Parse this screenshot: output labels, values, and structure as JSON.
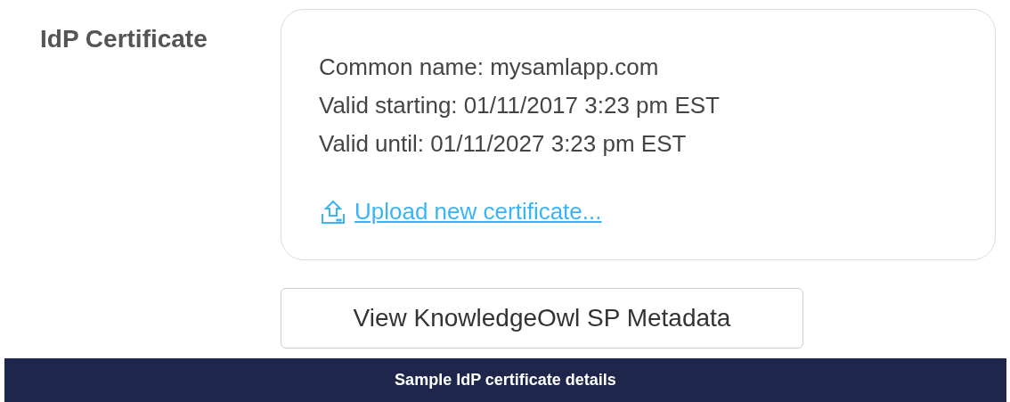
{
  "section_label": "IdP Certificate",
  "certificate": {
    "lines": [
      "Common name: mysamlapp.com",
      "Valid starting: 01/11/2017 3:23 pm EST",
      "Valid until: 01/11/2027 3:23 pm EST"
    ],
    "upload_link": "Upload new certificate..."
  },
  "metadata_button": "View KnowledgeOwl SP Metadata",
  "caption": "Sample IdP certificate details"
}
